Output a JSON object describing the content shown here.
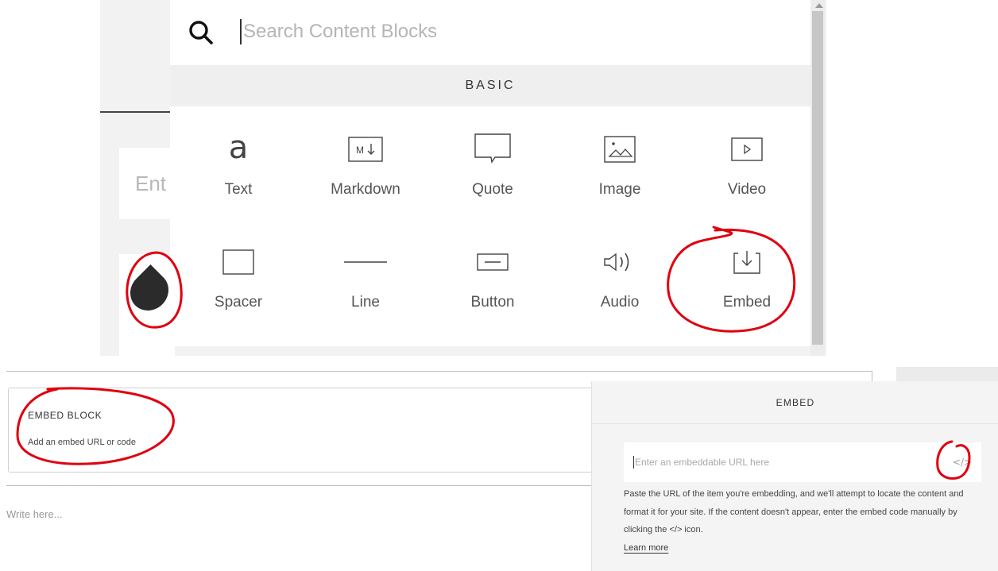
{
  "picker": {
    "search_placeholder": "Search Content Blocks",
    "section_title": "BASIC",
    "blocks": [
      {
        "label": "Text",
        "icon": "text-icon"
      },
      {
        "label": "Markdown",
        "icon": "markdown-icon"
      },
      {
        "label": "Quote",
        "icon": "quote-icon"
      },
      {
        "label": "Image",
        "icon": "image-icon"
      },
      {
        "label": "Video",
        "icon": "video-icon"
      },
      {
        "label": "Spacer",
        "icon": "spacer-icon"
      },
      {
        "label": "Line",
        "icon": "line-icon"
      },
      {
        "label": "Button",
        "icon": "button-icon"
      },
      {
        "label": "Audio",
        "icon": "audio-icon"
      },
      {
        "label": "Embed",
        "icon": "embed-icon"
      }
    ],
    "ghost_placeholder": "Ent"
  },
  "embed_block": {
    "title": "EMBED BLOCK",
    "subtitle": "Add an embed URL or code"
  },
  "editor": {
    "placeholder": "Write here..."
  },
  "embed_panel": {
    "title": "EMBED",
    "url_placeholder": "Enter an embeddable URL here",
    "code_icon_glyph": "</>",
    "help_text": "Paste the URL of the item you're embedding, and we'll attempt to locate the content and format it for your site. If the content doesn't appear, enter the embed code manually by clicking the </> icon.",
    "learn_more": "Learn more"
  },
  "colors": {
    "annotation": "#e0000f",
    "panel_bg": "#f4f4f4",
    "section_bg": "#efefef"
  }
}
